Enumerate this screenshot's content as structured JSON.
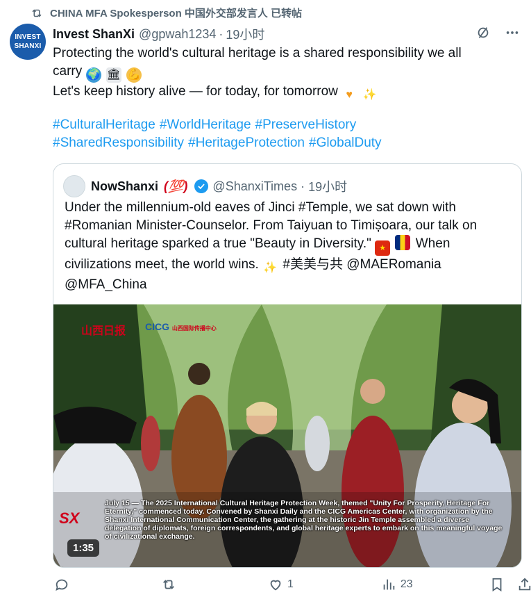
{
  "repost": {
    "label": "CHINA MFA Spokesperson 中国外交部发言人 已转帖"
  },
  "post": {
    "avatar_text_line1": "INVEST",
    "avatar_text_line2": "SHANXI",
    "author_name": "Invest ShanXi",
    "author_handle": "@gpwah1234",
    "time": "19小时",
    "text_line1": "Protecting the world's cultural heritage is a shared responsibility we all",
    "text_line2": "carry",
    "text_line3": "Let's keep history alive — for today, for tomorrow",
    "hashtags": [
      "#CulturalHeritage",
      "#WorldHeritage",
      "#PreserveHistory",
      "#SharedResponsibility",
      "#HeritageProtection",
      "#GlobalDuty"
    ]
  },
  "quote": {
    "author_name": "NowShanxi",
    "author_emoji": "(💯)",
    "author_handle": "@ShanxiTimes",
    "time": "19小时",
    "text_a": "Under the millennium-old eaves of Jinci #Temple, we sat down with #Romanian Minister-Counselor. From Taiyuan to Timișoara, our talk on cultural heritage sparked a true \"Beauty in Diversity.\"",
    "text_b": "When civilizations meet, the world wins.",
    "text_c": "#美美与共 @MAERomania @MFA_China",
    "video": {
      "watermark": "山西日报",
      "logo": "CICG",
      "logo_sub": "山西国际传播中心",
      "badge": "SX",
      "subtitle": "July 15 — The 2025 International Cultural Heritage Protection Week, themed \"Unity For Prosperity, Heritage For Eternity,\" commenced today. Convened by Shanxi Daily and the CICG Americas Center, with organization by the Shanxi International Communication Center, the gathering at the historic Jin Temple assembled a diverse delegation of diplomats, foreign correspondents, and global heritage experts to embark on this meaningful voyage of civilizational exchange.",
      "duration": "1:35"
    }
  },
  "actions": {
    "reply_count": "",
    "repost_count": "",
    "like_count": "1",
    "views_count": "23"
  },
  "colors": {
    "accent": "#1d9bf0",
    "muted": "#536471",
    "text": "#0f1419"
  }
}
